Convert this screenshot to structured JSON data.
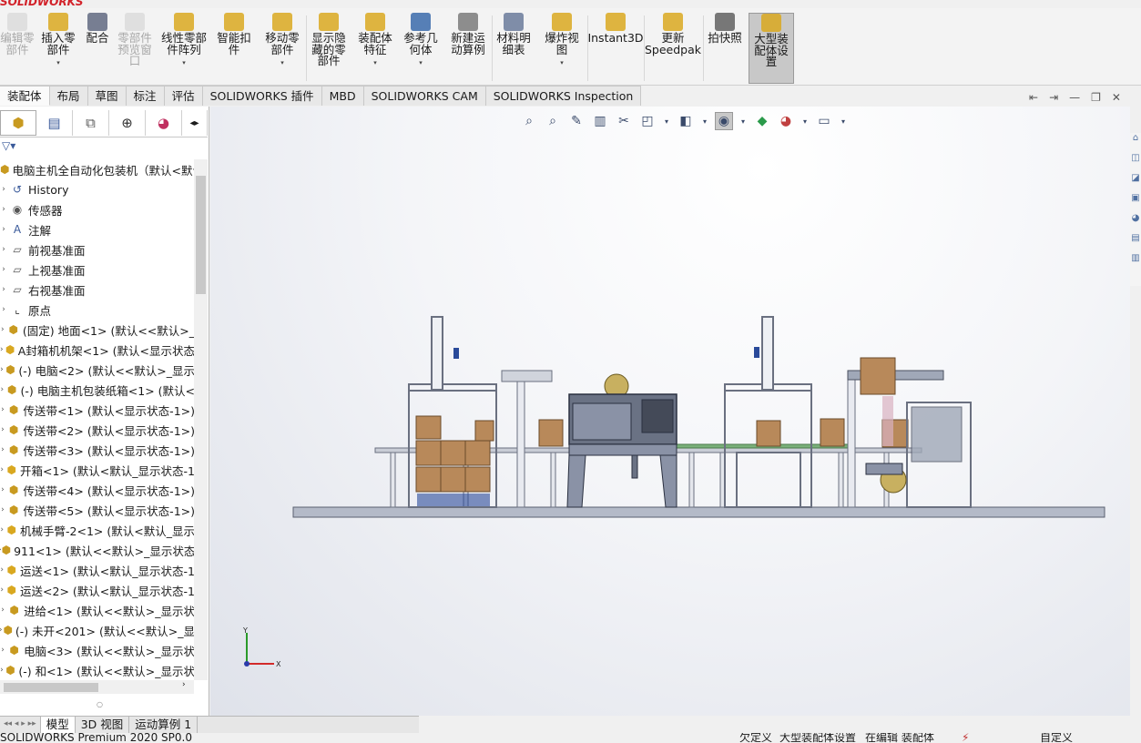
{
  "app": {
    "logo": "SOLIDWORKS"
  },
  "ribbon": {
    "buttons": [
      {
        "label": "编辑零\n部件",
        "disabled": true,
        "icon": "edit-component-icon"
      },
      {
        "label": "插入零\n部件",
        "disabled": false,
        "icon": "insert-component-icon",
        "dropdown": "▾"
      },
      {
        "label": "配合",
        "disabled": false,
        "icon": "mate-icon"
      },
      {
        "label": "零部件\n预览窗\n口",
        "disabled": true,
        "icon": "preview-window-icon"
      },
      {
        "label": "线性零部\n件阵列",
        "disabled": false,
        "icon": "linear-pattern-icon",
        "dropdown": "▾"
      },
      {
        "label": "智能扣\n件",
        "disabled": false,
        "icon": "smart-fasteners-icon"
      },
      {
        "label": "移动零\n部件",
        "disabled": false,
        "icon": "move-component-icon",
        "dropdown": "▾"
      },
      {
        "label": "显示隐\n藏的零\n部件",
        "disabled": false,
        "icon": "show-hidden-icon"
      },
      {
        "label": "装配体\n特征",
        "disabled": false,
        "icon": "assembly-features-icon",
        "dropdown": "▾"
      },
      {
        "label": "参考几\n何体",
        "disabled": false,
        "icon": "reference-geometry-icon",
        "dropdown": "▾"
      },
      {
        "label": "新建运\n动算例",
        "disabled": false,
        "icon": "new-motion-study-icon"
      },
      {
        "label": "材料明\n细表",
        "disabled": false,
        "icon": "bill-of-materials-icon"
      },
      {
        "label": "爆炸视\n图",
        "disabled": false,
        "icon": "exploded-view-icon",
        "dropdown": "▾"
      },
      {
        "label": "Instant3D",
        "disabled": false,
        "icon": "instant3d-icon"
      },
      {
        "label": "更新\nSpeedpak",
        "disabled": false,
        "icon": "speedpak-icon"
      },
      {
        "label": "拍快照",
        "disabled": false,
        "icon": "snapshot-icon"
      },
      {
        "label": "大型装\n配体设\n置",
        "disabled": false,
        "icon": "large-assembly-icon",
        "active": true
      }
    ]
  },
  "cmdtabs": [
    "装配体",
    "布局",
    "草图",
    "标注",
    "评估",
    "SOLIDWORKS 插件",
    "MBD",
    "SOLIDWORKS CAM",
    "SOLIDWORKS Inspection"
  ],
  "tree": {
    "root": "电脑主机全自动化包装机（默认<默认",
    "items": [
      {
        "label": "History",
        "icon": "history-icon"
      },
      {
        "label": "传感器",
        "icon": "sensor-icon"
      },
      {
        "label": "注解",
        "icon": "annotation-icon"
      },
      {
        "label": "前视基准面",
        "icon": "plane-icon"
      },
      {
        "label": "上视基准面",
        "icon": "plane-icon"
      },
      {
        "label": "右视基准面",
        "icon": "plane-icon"
      },
      {
        "label": "原点",
        "icon": "origin-icon"
      },
      {
        "label": "(固定) 地面<1> (默认<<默认>_",
        "icon": "part-icon"
      },
      {
        "label": "A封箱机机架<1> (默认<显示状态",
        "icon": "subassembly-icon"
      },
      {
        "label": "(-) 电脑<2> (默认<<默认>_显示",
        "icon": "part-icon"
      },
      {
        "label": "(-) 电脑主机包装纸箱<1> (默认<",
        "icon": "part-icon"
      },
      {
        "label": "传送带<1> (默认<显示状态-1>)",
        "icon": "part-icon"
      },
      {
        "label": "传送带<2> (默认<显示状态-1>)",
        "icon": "part-icon"
      },
      {
        "label": "传送带<3> (默认<显示状态-1>)",
        "icon": "part-icon"
      },
      {
        "label": "开箱<1> (默认<默认_显示状态-1",
        "icon": "subassembly-icon"
      },
      {
        "label": "传送带<4> (默认<显示状态-1>)",
        "icon": "part-icon"
      },
      {
        "label": "传送带<5> (默认<显示状态-1>)",
        "icon": "part-icon"
      },
      {
        "label": "机械手臂-2<1> (默认<默认_显示",
        "icon": "subassembly-icon"
      },
      {
        "label": "911<1> (默认<<默认>_显示状态",
        "icon": "part-icon"
      },
      {
        "label": "运送<1> (默认<默认_显示状态-1",
        "icon": "subassembly-icon"
      },
      {
        "label": "运送<2> (默认<默认_显示状态-1",
        "icon": "subassembly-icon"
      },
      {
        "label": "进给<1> (默认<<默认>_显示状",
        "icon": "part-icon"
      },
      {
        "label": "(-) 未开<201> (默认<<默认>_显",
        "icon": "part-icon"
      },
      {
        "label": "电脑<3> (默认<<默认>_显示状",
        "icon": "part-icon"
      },
      {
        "label": "(-) 和<1> (默认<<默认>_显示状",
        "icon": "part-icon"
      }
    ]
  },
  "bottabs": [
    "模型",
    "3D 视图",
    "运动算例 1"
  ],
  "status": {
    "left": "SOLIDWORKS Premium 2020 SP0.0",
    "mid1": "欠定义",
    "mid2": "大型装配体设置",
    "mid3": "在编辑 装配体",
    "right": "自定义"
  },
  "triad": {
    "x": "X",
    "y": "Y"
  },
  "colors": {
    "accent": "#d2222a",
    "ribbon_bg": "#f3f3f3",
    "ground": "#b6bccb",
    "frame": "#7a8194",
    "box": "#b8895a"
  }
}
